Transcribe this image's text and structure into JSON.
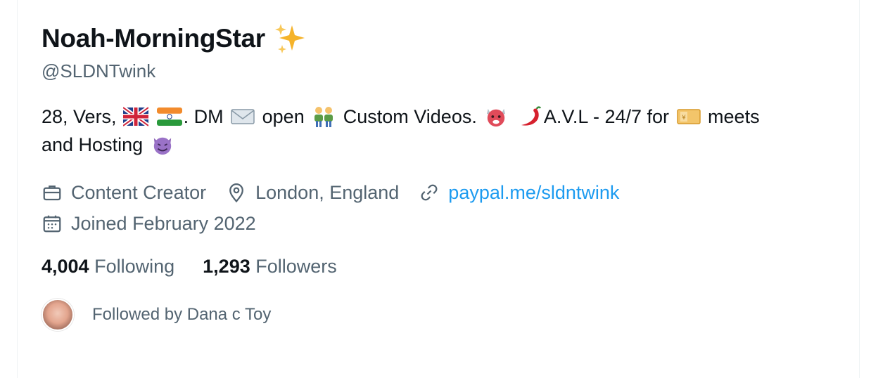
{
  "profile": {
    "display_name": "Noah-MorningStar",
    "handle": "@SLDNTwink"
  },
  "bio": {
    "seg1": "28, Vers,",
    "seg2": ". DM",
    "seg3": "open",
    "seg4": "Custom Videos.",
    "seg5": "A.V.L - 24/7 for",
    "seg6": "meets",
    "seg7": "and Hosting"
  },
  "meta": {
    "profession": "Content Creator",
    "location": "London, England",
    "website": "paypal.me/sldntwink",
    "joined": "Joined February 2022"
  },
  "stats": {
    "following_count": "4,004",
    "following_label": "Following",
    "followers_count": "1,293",
    "followers_label": "Followers"
  },
  "followed_by": {
    "text": "Followed by Dana c Toy"
  },
  "icons": {
    "name_badge": "sparkles-icon",
    "profession": "briefcase-icon",
    "location": "location-pin-icon",
    "website": "link-icon",
    "joined": "calendar-icon"
  },
  "colors": {
    "text_primary": "#0f1419",
    "text_secondary": "#536471",
    "link": "#1d9bf0"
  }
}
